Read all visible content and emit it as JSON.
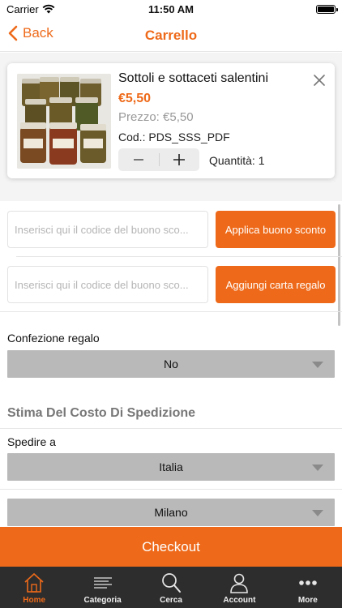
{
  "status_bar": {
    "carrier": "Carrier",
    "time": "11:50 AM"
  },
  "nav": {
    "back_label": "Back",
    "title": "Carrello"
  },
  "cart_item": {
    "name": "Sottoli e sottaceti salentini",
    "price": "€5,50",
    "prezzo": "Prezzo: €5,50",
    "code": "Cod.: PDS_SSS_PDF",
    "quantity_label": "Quantità: 1",
    "minus": "—",
    "plus": "+"
  },
  "coupon": {
    "placeholder": "Inserisci qui il codice del buono sco...",
    "button_label": "Applica buono sconto"
  },
  "gift_card": {
    "placeholder": "Inserisci qui il codice del buono sco...",
    "button_label": "Aggiungi carta regalo"
  },
  "gift_wrap": {
    "label": "Confezione regalo",
    "selected": "No"
  },
  "shipping": {
    "title": "Stima Del Costo Di Spedizione",
    "ship_to_label": "Spedire a",
    "country": "Italia",
    "city": "Milano"
  },
  "checkout_label": "Checkout",
  "tabs": [
    {
      "label": "Home",
      "icon": "home-icon",
      "active": true
    },
    {
      "label": "Categoria",
      "icon": "category-icon",
      "active": false
    },
    {
      "label": "Cerca",
      "icon": "search-icon",
      "active": false
    },
    {
      "label": "Account",
      "icon": "account-icon",
      "active": false
    },
    {
      "label": "More",
      "icon": "more-icon",
      "active": false
    }
  ],
  "colors": {
    "accent": "#ee6a1a",
    "tabbar": "#2d2d2d",
    "select": "#b9b9b9"
  }
}
